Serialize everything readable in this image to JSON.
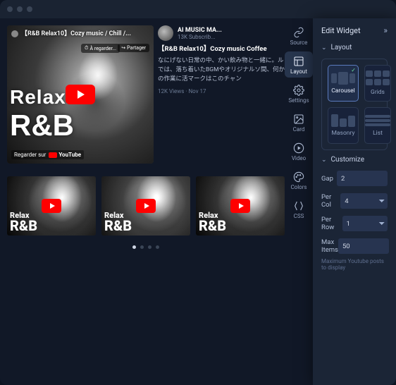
{
  "video": {
    "title": "【R&B Relax10】Cozy music / Chill /...",
    "watch_later": "À regarder...",
    "share": "Partager",
    "overlay_relax": "Relax",
    "overlay_rb": "R&B",
    "watch_on_label": "Regarder sur",
    "watch_on_brand": "YouTube"
  },
  "channel": {
    "name": "AI MUSIC MA...",
    "subs": "13K Subscrib..."
  },
  "info": {
    "title": "【R&B Relax10】Cozy music Coffee",
    "desc": "なにげない日常の中、かい飲み物と一緒に。ルでは、落ち着いたBGMやオリジナルソ間、何かの作業に活マークはこのチャン",
    "meta": "12K Views · Nov 17"
  },
  "thumbs": [
    {
      "r1": "Relax",
      "r2": "R&B"
    },
    {
      "r1": "Relax",
      "r2": "R&B"
    },
    {
      "r1": "Relax",
      "r2": "R&B"
    }
  ],
  "iconbar": {
    "source": "Source",
    "layout": "Layout",
    "settings": "Settings",
    "card": "Card",
    "video": "Video",
    "colors": "Colors",
    "css": "CSS"
  },
  "panel": {
    "title": "Edit Widget",
    "sec_layout": "Layout",
    "sec_customize": "Customize",
    "opts": {
      "carousel": "Carousel",
      "grids": "Grids",
      "masonry": "Masonry",
      "list": "List"
    },
    "gap_label": "Gap",
    "gap_value": "2",
    "percol_label": "Per Col",
    "percol_value": "4",
    "perrow_label": "Per Row",
    "perrow_value": "1",
    "max_label": "Max Items",
    "max_value": "50",
    "max_hint": "Maximum Youtube posts to display"
  }
}
